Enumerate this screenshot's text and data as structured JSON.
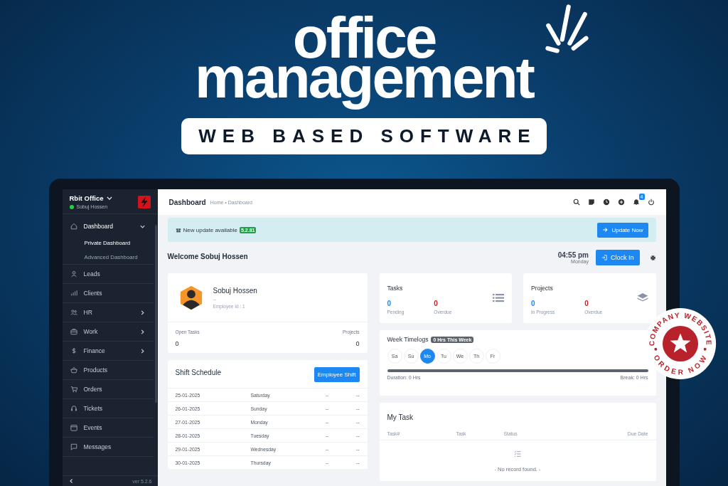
{
  "headline": {
    "lines": [
      "office",
      "management"
    ],
    "subtitle": "WEB BASED SOFTWARE"
  },
  "stamp": {
    "top_text": "COMPANY WEBSITE",
    "bottom_text": "ORDER NOW"
  },
  "sidebar": {
    "company": "Rbit Office",
    "user": "Sobuj Hossen",
    "online": true,
    "version": "ver 5.2.6",
    "items": [
      {
        "label": "Dashboard",
        "expanded": true,
        "children": [
          {
            "label": "Private Dashboard",
            "selected": true
          },
          {
            "label": "Advanced Dashboard",
            "selected": false
          }
        ]
      },
      {
        "label": "Leads"
      },
      {
        "label": "Clients"
      },
      {
        "label": "HR",
        "expanded": false
      },
      {
        "label": "Work",
        "expanded": false
      },
      {
        "label": "Finance",
        "expanded": false
      },
      {
        "label": "Products"
      },
      {
        "label": "Orders"
      },
      {
        "label": "Tickets"
      },
      {
        "label": "Events"
      },
      {
        "label": "Messages"
      }
    ]
  },
  "topbar": {
    "title": "Dashboard",
    "breadcrumb": "Home • Dashboard",
    "notification_count": "4"
  },
  "update_banner": {
    "text": "New update available",
    "version": "5.2.81",
    "button": "Update Now"
  },
  "welcome": {
    "text": "Welcome Sobuj Hossen",
    "time": "04:55 pm",
    "day": "Monday",
    "button": "Clock In"
  },
  "profile": {
    "name": "Sobuj Hossen",
    "designation": "--",
    "employee_id": "Employee Id : 1",
    "stats": [
      {
        "label": "Open Tasks",
        "value": "0"
      },
      {
        "label": "Projects",
        "value": "0"
      }
    ]
  },
  "shift_schedule": {
    "title": "Shift Schedule",
    "button": "Employee Shift",
    "rows": [
      [
        "25-01-2025",
        "Saturday",
        "--",
        "--"
      ],
      [
        "26-01-2025",
        "Sunday",
        "--",
        "--"
      ],
      [
        "27-01-2025",
        "Monday",
        "--",
        "--"
      ],
      [
        "28-01-2025",
        "Tuesday",
        "--",
        "--"
      ],
      [
        "29-01-2025",
        "Wednesday",
        "--",
        "--"
      ],
      [
        "30-01-2025",
        "Thursday",
        "--",
        "--"
      ]
    ]
  },
  "stat_cards": [
    {
      "title": "Tasks",
      "stats": [
        {
          "value": "0",
          "label": "Pending",
          "kind": "neutral"
        },
        {
          "value": "0",
          "label": "Overdue",
          "kind": "danger"
        }
      ]
    },
    {
      "title": "Projects",
      "stats": [
        {
          "value": "0",
          "label": "In Progress",
          "kind": "neutral"
        },
        {
          "value": "0",
          "label": "Overdue",
          "kind": "danger"
        }
      ]
    }
  ],
  "week_timelogs": {
    "title": "Week Timelogs",
    "badge": "0 Hrs This Week",
    "days": [
      {
        "label": "Sa",
        "selected": false
      },
      {
        "label": "Su",
        "selected": false
      },
      {
        "label": "Mo",
        "selected": true
      },
      {
        "label": "Tu",
        "selected": false
      },
      {
        "label": "We",
        "selected": false
      },
      {
        "label": "Th",
        "selected": false
      },
      {
        "label": "Fr",
        "selected": false
      }
    ],
    "duration": "Duration: 0 Hrs",
    "break": "Break: 0 Hrs"
  },
  "my_task": {
    "title": "My Task",
    "columns": [
      "Task#",
      "Task",
      "Status",
      "Due Date"
    ],
    "empty_text": "- No record found. -"
  }
}
